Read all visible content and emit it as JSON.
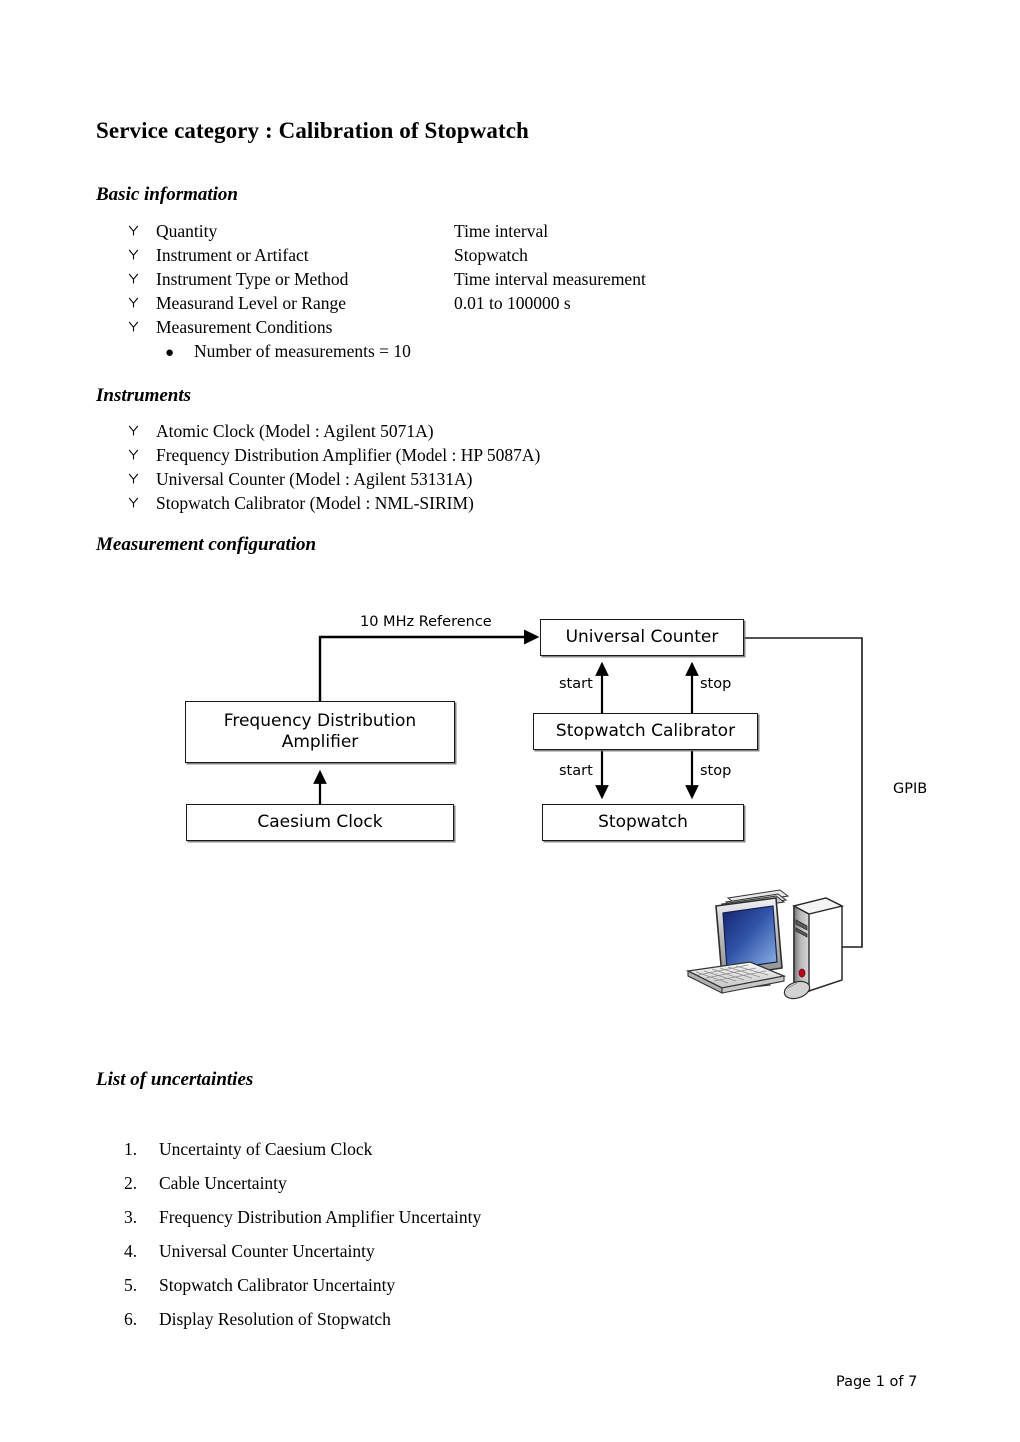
{
  "document": {
    "title": "Service category : Calibration of Stopwatch",
    "footer": "Page 1 of 7"
  },
  "sections": {
    "basic": {
      "heading": "Basic information",
      "bullet_icon": "wingdings-trefoil-bullet",
      "sub_bullet_icon": "filled-circle-bullet",
      "items": [
        {
          "label": "Quantity",
          "value": "Time interval"
        },
        {
          "label": "Instrument or Artifact",
          "value": "Stopwatch"
        },
        {
          "label": "Instrument Type or Method",
          "value": "Time interval measurement"
        },
        {
          "label": "Measurand Level or Range",
          "value": "0.01 to 100000 s"
        },
        {
          "label": "Measurement Conditions",
          "value": ""
        }
      ],
      "sub_items": [
        "Number of measurements = 10"
      ]
    },
    "instruments": {
      "heading": "Instruments",
      "items": [
        "Atomic Clock (Model : Agilent 5071A)",
        "Frequency Distribution Amplifier (Model : HP 5087A)",
        "Universal Counter (Model : Agilent 53131A)",
        "Stopwatch Calibrator (Model : NML-SIRIM)"
      ]
    },
    "configuration": {
      "heading": "Measurement configuration"
    },
    "uncertainties": {
      "heading": "List of uncertainties",
      "items": [
        {
          "number": "1.",
          "text": "Uncertainty of Caesium Clock"
        },
        {
          "number": "2.",
          "text": "Cable Uncertainty"
        },
        {
          "number": "3.",
          "text": "Frequency Distribution Amplifier Uncertainty"
        },
        {
          "number": "4.",
          "text": "Universal Counter Uncertainty"
        },
        {
          "number": "5.",
          "text": "Stopwatch Calibrator Uncertainty"
        },
        {
          "number": "6.",
          "text": "Display Resolution of Stopwatch"
        }
      ]
    }
  },
  "diagram": {
    "boxes": {
      "universal_counter": "Universal Counter",
      "frequency_distribution_amplifier": "Frequency Distribution\nAmplifier",
      "frequency_distribution_amplifier_line1": "Frequency Distribution",
      "frequency_distribution_amplifier_line2": "Amplifier",
      "stopwatch_calibrator": "Stopwatch Calibrator",
      "caesium_clock": "Caesium Clock",
      "stopwatch": "Stopwatch"
    },
    "connection_labels": {
      "reference": "10 MHz Reference",
      "gpib": "GPIB",
      "counter_start": "start",
      "counter_stop": "stop",
      "stopwatch_start": "start",
      "stopwatch_stop": "stop"
    },
    "clipart": "desktop-computer",
    "colors": {
      "box_border": "#1a1a1a",
      "box_shadow": "#6e6e6e",
      "screen_dark": "#15216b",
      "screen_light": "#7aa7e0",
      "tower_led": "#c00018",
      "case_gray": "#a8a8a8"
    }
  }
}
